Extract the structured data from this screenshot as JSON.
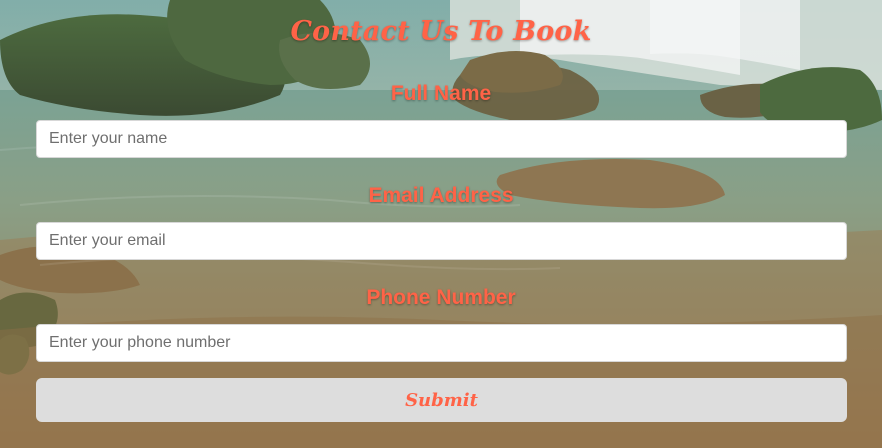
{
  "form": {
    "title": "Contact Us To Book",
    "fields": [
      {
        "label": "Full Name",
        "placeholder": "Enter your name"
      },
      {
        "label": "Email Address",
        "placeholder": "Enter your email"
      },
      {
        "label": "Phone Number",
        "placeholder": "Enter your phone number"
      }
    ],
    "submit_label": "Submit"
  },
  "colors": {
    "accent": "#ff6347",
    "input_background": "#ffffff",
    "button_background": "#dddddd"
  },
  "background": {
    "image": "waterfall-river-landscape"
  }
}
